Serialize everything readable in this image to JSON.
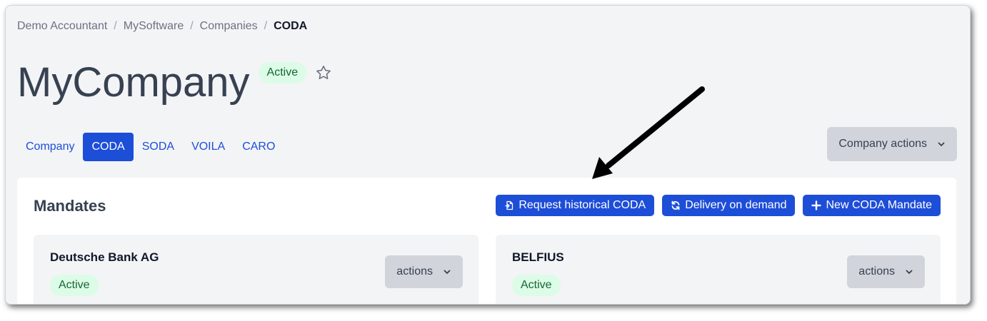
{
  "breadcrumb": [
    "Demo Accountant",
    "MySoftware",
    "Companies",
    "CODA"
  ],
  "breadcrumb_separator": "/",
  "page": {
    "title": "MyCompany",
    "status": "Active"
  },
  "tabs": [
    {
      "label": "Company",
      "active": false
    },
    {
      "label": "CODA",
      "active": true
    },
    {
      "label": "SODA",
      "active": false
    },
    {
      "label": "VOILA",
      "active": false
    },
    {
      "label": "CARO",
      "active": false
    }
  ],
  "company_actions_label": "Company actions",
  "mandates": {
    "title": "Mandates",
    "buttons": {
      "request_historical": "Request historical CODA",
      "delivery_on_demand": "Delivery on demand",
      "new_mandate": "New CODA Mandate"
    },
    "cards": [
      {
        "bank": "Deutsche Bank AG",
        "status": "Active",
        "actions_label": "actions"
      },
      {
        "bank": "BELFIUS",
        "status": "Active",
        "actions_label": "actions"
      }
    ]
  },
  "colors": {
    "primary": "#1d4ed8",
    "active_badge_bg": "#dcfce7",
    "active_badge_text": "#166534"
  },
  "icons": [
    "star-icon",
    "chevron-down-icon",
    "document-icon",
    "refresh-icon",
    "plus-icon",
    "annotation-arrow"
  ]
}
